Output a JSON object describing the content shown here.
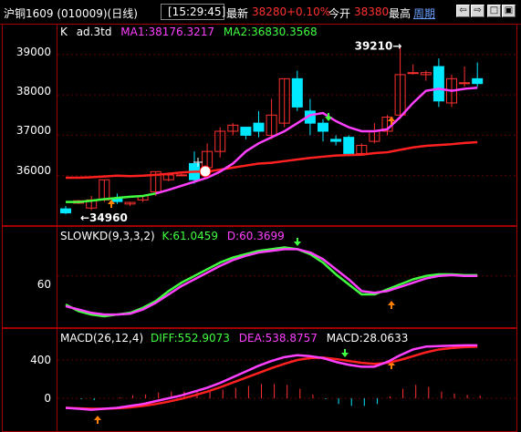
{
  "topbar": {
    "title": "沪铜1609 (010009)(日线)",
    "time": "[15:29:45]",
    "latest_label": "最新",
    "latest_value": "38280",
    "change_pct": "+0.10%",
    "open_label": "今开",
    "open_value": "38380",
    "high_label": "最高",
    "period_link": "周期",
    "buttons": [
      "⇦",
      "⇨",
      "□",
      "▣"
    ]
  },
  "kline_panel": {
    "header": {
      "k": "K",
      "name": "ad.3td",
      "ma1": "MA1:38176.3217",
      "ma2": "MA2:36830.3568"
    },
    "y_labels": [
      "39000",
      "38000",
      "37000",
      "36000"
    ],
    "high_annotation": "39210→",
    "low_annotation": "←34960",
    "colors": {
      "up": "#ff3030",
      "down": "#00e8ff",
      "ma1": "#ff40ff",
      "ma2": "#ff2020",
      "ma1_alt": "#40ff40"
    }
  },
  "kd_panel": {
    "header": {
      "name": "SLOWKD(9,3,3,2)",
      "k": "K:61.0459",
      "d": "D:60.3699"
    },
    "y_labels": [
      "60"
    ]
  },
  "macd_panel": {
    "header": {
      "name": "MACD(26,12,4)",
      "diff": "DIFF:552.9073",
      "dea": "DEA:538.8757",
      "macd": "MACD:28.0633"
    },
    "y_labels": [
      "400",
      "0"
    ]
  },
  "chart_data": {
    "type": "candlestick",
    "y_range": [
      34800,
      39400
    ],
    "candles": [
      {
        "o": 35180,
        "h": 35250,
        "c": 35080,
        "l": 35050
      },
      {
        "o": 35320,
        "h": 35400,
        "c": 35380,
        "l": 35300
      },
      {
        "o": 35200,
        "h": 35500,
        "c": 35400,
        "l": 35150
      },
      {
        "o": 35400,
        "h": 35900,
        "c": 35900,
        "l": 35350
      },
      {
        "o": 35440,
        "h": 35560,
        "c": 35360,
        "l": 35300
      },
      {
        "o": 35300,
        "h": 35350,
        "c": 35340,
        "l": 35250
      },
      {
        "o": 35400,
        "h": 35500,
        "c": 35500,
        "l": 35350
      },
      {
        "o": 35600,
        "h": 36100,
        "c": 36100,
        "l": 35500
      },
      {
        "o": 35900,
        "h": 36080,
        "c": 36020,
        "l": 35860
      },
      {
        "o": 36020,
        "h": 36050,
        "c": 36020,
        "l": 35980
      },
      {
        "o": 36300,
        "h": 36600,
        "c": 35900,
        "l": 35800
      },
      {
        "o": 36200,
        "h": 36800,
        "c": 36600,
        "l": 36000
      },
      {
        "o": 36600,
        "h": 37200,
        "c": 37100,
        "l": 36450
      },
      {
        "o": 37100,
        "h": 37300,
        "c": 37250,
        "l": 37000
      },
      {
        "o": 37200,
        "h": 37200,
        "c": 37000,
        "l": 36900
      },
      {
        "o": 37300,
        "h": 37600,
        "c": 37100,
        "l": 36950
      },
      {
        "o": 37000,
        "h": 37900,
        "c": 37500,
        "l": 36900
      },
      {
        "o": 37300,
        "h": 38400,
        "c": 38400,
        "l": 37200
      },
      {
        "o": 38400,
        "h": 38600,
        "c": 37700,
        "l": 37600
      },
      {
        "o": 37600,
        "h": 37900,
        "c": 37300,
        "l": 37000
      },
      {
        "o": 37300,
        "h": 37400,
        "c": 37100,
        "l": 36850
      },
      {
        "o": 36900,
        "h": 37000,
        "c": 36850,
        "l": 36750
      },
      {
        "o": 36950,
        "h": 37000,
        "c": 36550,
        "l": 36500
      },
      {
        "o": 36550,
        "h": 36800,
        "c": 36750,
        "l": 36550
      },
      {
        "o": 36850,
        "h": 37300,
        "c": 37100,
        "l": 36800
      },
      {
        "o": 37100,
        "h": 37500,
        "c": 37450,
        "l": 37000
      },
      {
        "o": 37500,
        "h": 39210,
        "c": 38500,
        "l": 37400
      },
      {
        "o": 38550,
        "h": 38750,
        "c": 38550,
        "l": 38500
      },
      {
        "o": 38500,
        "h": 38600,
        "c": 38550,
        "l": 38350
      },
      {
        "o": 38700,
        "h": 38900,
        "c": 37850,
        "l": 37700
      },
      {
        "o": 37800,
        "h": 38500,
        "c": 38400,
        "l": 37700
      },
      {
        "o": 38300,
        "h": 38700,
        "c": 38300,
        "l": 38200
      },
      {
        "o": 38400,
        "h": 38800,
        "c": 38280,
        "l": 38200
      }
    ],
    "ma1": [
      35350,
      35350,
      35380,
      35420,
      35450,
      35480,
      35500,
      35560,
      35650,
      35750,
      35850,
      35950,
      36100,
      36300,
      36600,
      36800,
      36950,
      37100,
      37300,
      37500,
      37550,
      37350,
      37200,
      37100,
      37100,
      37150,
      37450,
      37800,
      38100,
      38150,
      38100,
      38150,
      38176
    ],
    "ma2": [
      35950,
      35950,
      35960,
      35980,
      36000,
      35990,
      36000,
      36020,
      36050,
      36080,
      36100,
      36100,
      36150,
      36200,
      36250,
      36300,
      36320,
      36360,
      36400,
      36440,
      36470,
      36500,
      36510,
      36520,
      36560,
      36580,
      36640,
      36700,
      36740,
      36760,
      36780,
      36810,
      36830
    ],
    "kd_k": [
      26,
      18,
      14,
      12,
      14,
      16,
      22,
      30,
      42,
      52,
      60,
      68,
      76,
      82,
      86,
      90,
      92,
      94,
      92,
      86,
      76,
      62,
      50,
      38,
      38,
      44,
      50,
      56,
      60,
      62,
      62,
      61,
      61
    ],
    "kd_d": [
      24,
      20,
      16,
      14,
      14,
      15,
      20,
      28,
      38,
      48,
      56,
      64,
      72,
      79,
      84,
      88,
      90,
      92,
      92,
      88,
      80,
      68,
      56,
      42,
      40,
      42,
      47,
      52,
      57,
      60,
      61,
      60,
      60
    ],
    "macd_diff": [
      -100,
      -110,
      -120,
      -110,
      -100,
      -80,
      -60,
      -30,
      0,
      30,
      70,
      110,
      160,
      220,
      280,
      340,
      390,
      430,
      450,
      440,
      420,
      380,
      350,
      330,
      330,
      380,
      450,
      510,
      540,
      545,
      550,
      553,
      553
    ],
    "macd_dea": [
      -100,
      -105,
      -110,
      -110,
      -105,
      -95,
      -80,
      -60,
      -35,
      -5,
      30,
      70,
      115,
      165,
      215,
      265,
      315,
      360,
      400,
      420,
      425,
      410,
      390,
      370,
      360,
      370,
      400,
      440,
      480,
      510,
      525,
      535,
      539
    ]
  }
}
